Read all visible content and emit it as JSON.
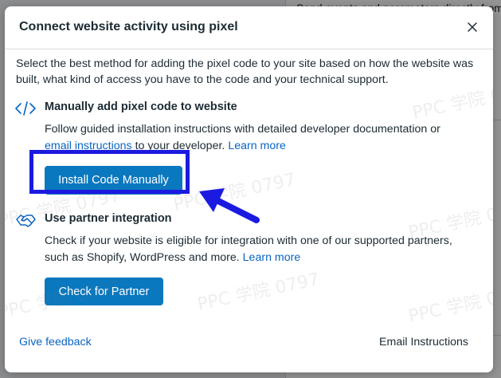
{
  "dialog": {
    "title": "Connect website activity using pixel",
    "intro": "Select the best method for adding the pixel code to your site based on how the website was built, what kind of access you have to the code and your technical support."
  },
  "manual": {
    "icon": "code-icon",
    "title": "Manually add pixel code to website",
    "desc_part1": "Follow guided installation instructions with detailed developer documentation or",
    "email_link": "email instructions",
    "desc_part2": "to your developer.",
    "learn_more": "Learn more",
    "button": "Install Code Manually"
  },
  "partner": {
    "icon": "handshake-icon",
    "title": "Use partner integration",
    "desc": "Check if your website is eligible for integration with one of our supported partners, such as Shopify, WordPress and more.",
    "learn_more": "Learn more",
    "button": "Check for Partner"
  },
  "footer": {
    "feedback": "Give feedback",
    "email_instructions": "Email Instructions"
  },
  "background": {
    "top_text": "Send events and parameters directly from"
  },
  "watermark": "PPC 学院 0797",
  "colors": {
    "primary_button": "#0a78be",
    "link": "#0a64c2",
    "highlight": "#1a1ae0"
  }
}
